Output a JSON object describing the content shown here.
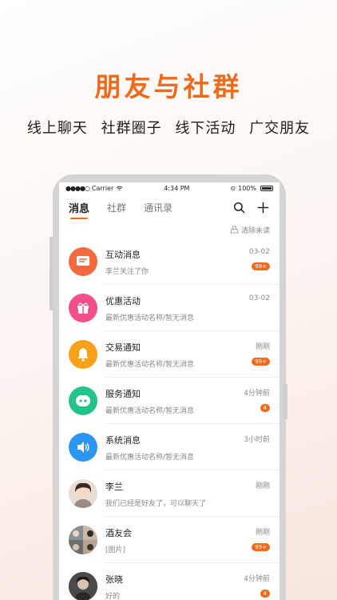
{
  "promo": {
    "headline": "朋友与社群",
    "subline": "线上聊天 社群圈子 线下活动 广交朋友"
  },
  "status_bar": {
    "carrier": "Carrier",
    "time": "4:34 PM",
    "battery": "100%"
  },
  "tabs": [
    {
      "label": "消息",
      "active": true
    },
    {
      "label": "社群",
      "active": false
    },
    {
      "label": "通讯录",
      "active": false
    }
  ],
  "clear_unread": "清除未读",
  "accent_color": "#f06a1e",
  "messages": [
    {
      "title": "互动消息",
      "subtitle": "李兰关注了你",
      "time": "03-02",
      "badge": "99+",
      "icon": "message-icon",
      "color": "#f26a3c"
    },
    {
      "title": "优惠活动",
      "subtitle": "最新优惠活动名称/暂无消息",
      "time": "03-02",
      "badge": "",
      "icon": "gift-icon",
      "color": "#f34f8a"
    },
    {
      "title": "交易通知",
      "subtitle": "最新优惠活动名称/暂无消息",
      "time": "刚刚",
      "badge": "99+",
      "icon": "bell-icon",
      "color": "#f8a21c"
    },
    {
      "title": "服务通知",
      "subtitle": "最新优惠活动名称/暂无消息",
      "time": "4分钟前",
      "badge": "4",
      "icon": "service-icon",
      "color": "#24c38a"
    },
    {
      "title": "系统消息",
      "subtitle": "最新优惠活动名称/暂无消息",
      "time": "3小时前",
      "badge": "",
      "icon": "speaker-icon",
      "color": "#2c96f5"
    },
    {
      "title": "李兰",
      "subtitle": "我们已经是好友了，可以聊天了",
      "time": "刚刚",
      "badge": "",
      "icon": "user-avatar",
      "color": "#d9c3b5"
    },
    {
      "title": "酒友会",
      "subtitle": "[图片]",
      "time": "刚刚",
      "badge": "99+",
      "icon": "group-avatar",
      "color": "#a7a7a7"
    },
    {
      "title": "张晓",
      "subtitle": "好的",
      "time": "4分钟前",
      "badge": "4",
      "icon": "user-avatar",
      "color": "#5b5b5b"
    }
  ]
}
